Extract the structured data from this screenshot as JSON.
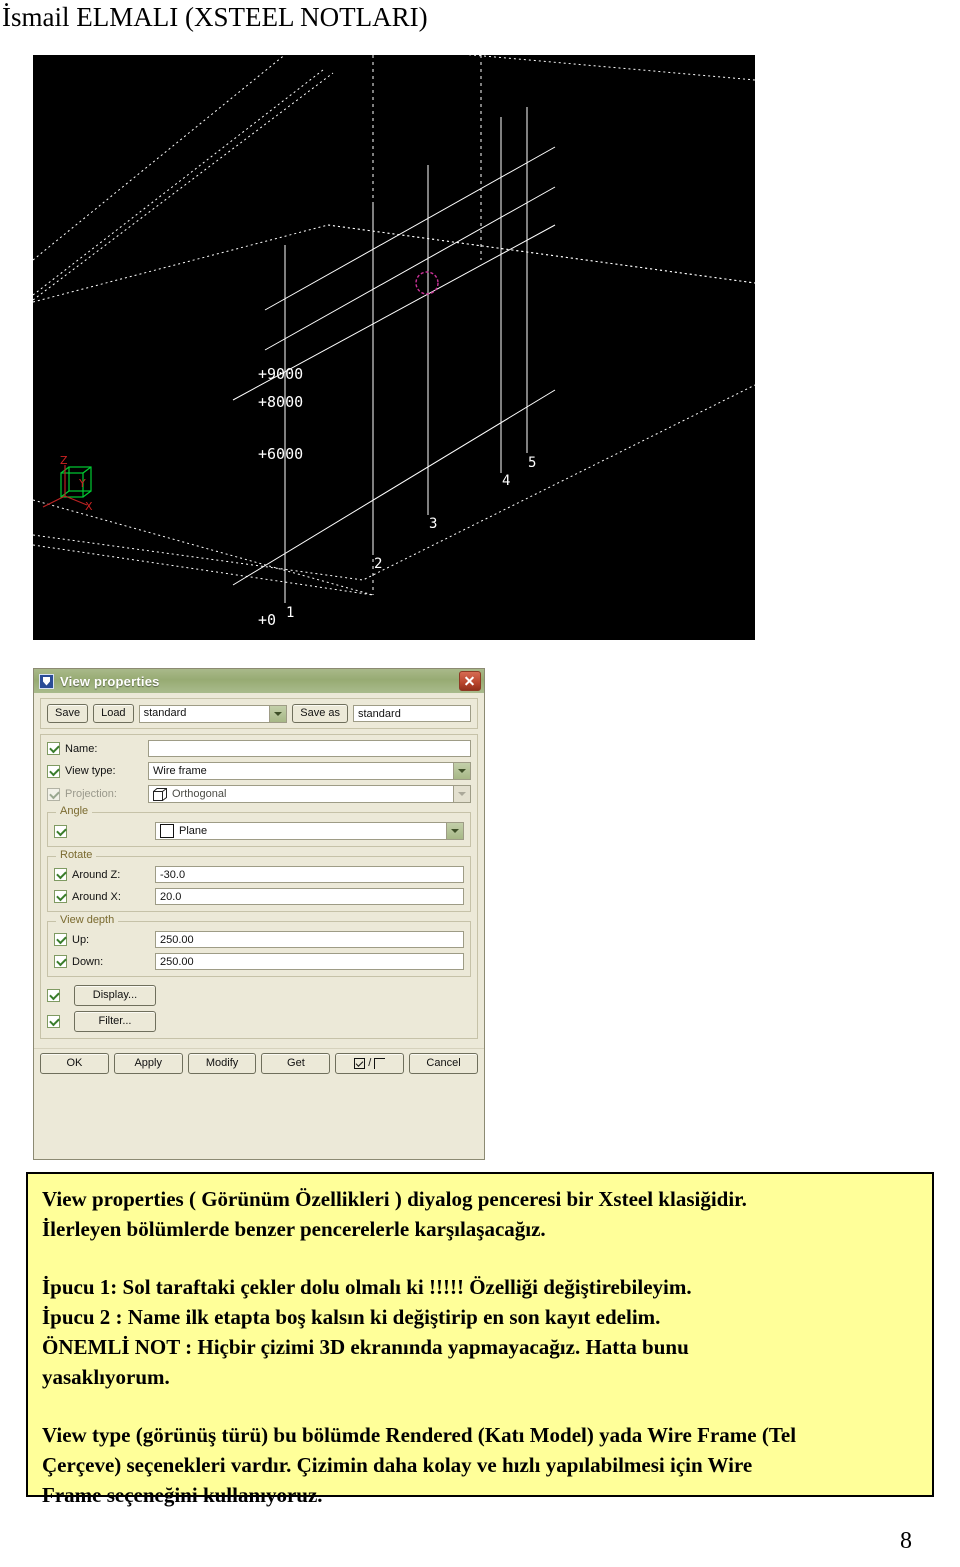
{
  "document": {
    "header": "İsmail ELMALI (XSTEEL NOTLARI)",
    "page_number": "8"
  },
  "viewport": {
    "background_color": "#000000",
    "grid_line_color": "#ffffff",
    "axis_label_color": "#cc2222",
    "axis_cube_color": "#00cc33",
    "selection_color": "#cc33aa",
    "level_labels": [
      "+9000",
      "+8000",
      "+6000",
      "+0"
    ],
    "grid_labels": [
      "1",
      "2",
      "3",
      "4",
      "5"
    ],
    "axis_labels": [
      "Z",
      "Y",
      "X"
    ]
  },
  "dialog": {
    "title": "View properties",
    "app_icon": "tekla-icon",
    "close_icon": "close-icon",
    "preset": {
      "save_label": "Save",
      "load_label": "Load",
      "preset_value": "standard",
      "save_as_label": "Save as",
      "save_as_value": "standard"
    },
    "fields": {
      "name_label": "Name:",
      "name_value": "",
      "view_type_label": "View type:",
      "view_type_value": "Wire frame",
      "projection_label": "Projection:",
      "projection_value": "Orthogonal"
    },
    "angle_group": {
      "title": "Angle",
      "plane_value": "Plane"
    },
    "rotate_group": {
      "title": "Rotate",
      "around_z_label": "Around Z:",
      "around_z_value": "-30.0",
      "around_x_label": "Around X:",
      "around_x_value": "20.0"
    },
    "view_depth_group": {
      "title": "View depth",
      "up_label": "Up:",
      "up_value": "250.00",
      "down_label": "Down:",
      "down_value": "250.00"
    },
    "extra_buttons": {
      "display_label": "Display...",
      "filter_label": "Filter..."
    },
    "actions": {
      "ok_label": "OK",
      "apply_label": "Apply",
      "modify_label": "Modify",
      "get_label": "Get",
      "toggle_label": "/",
      "cancel_label": "Cancel"
    },
    "colors": {
      "titlebar": "#97ab73",
      "face": "#ece9d8",
      "close_button": "#b9452c",
      "check_mark": "#3a7d2c"
    }
  },
  "note": {
    "background_color": "#ffff99",
    "line1": "View properties ( Görünüm Özellikleri ) diyalog penceresi bir Xsteel klasiğidir.",
    "line2": "İlerleyen bölümlerde benzer pencerelerle karşılaşacağız.",
    "line3": "İpucu 1: Sol taraftaki çekler dolu olmalı ki !!!!! Özelliği değiştirebileyim.",
    "line4": "İpucu 2 : Name ilk etapta boş kalsın ki değiştirip en son kayıt edelim.",
    "line5": "ÖNEMLİ NOT : Hiçbir çizimi 3D ekranında yapmayacağız. Hatta bunu",
    "line6": "yasaklıyorum.",
    "line7": "View type (görünüş türü) bu bölümde Rendered (Katı Model) yada Wire Frame (Tel",
    "line8": "Çerçeve) seçenekleri vardır. Çizimin daha kolay ve hızlı yapılabilmesi için Wire",
    "line9": "Frame seçeneğini kullanıyoruz."
  }
}
